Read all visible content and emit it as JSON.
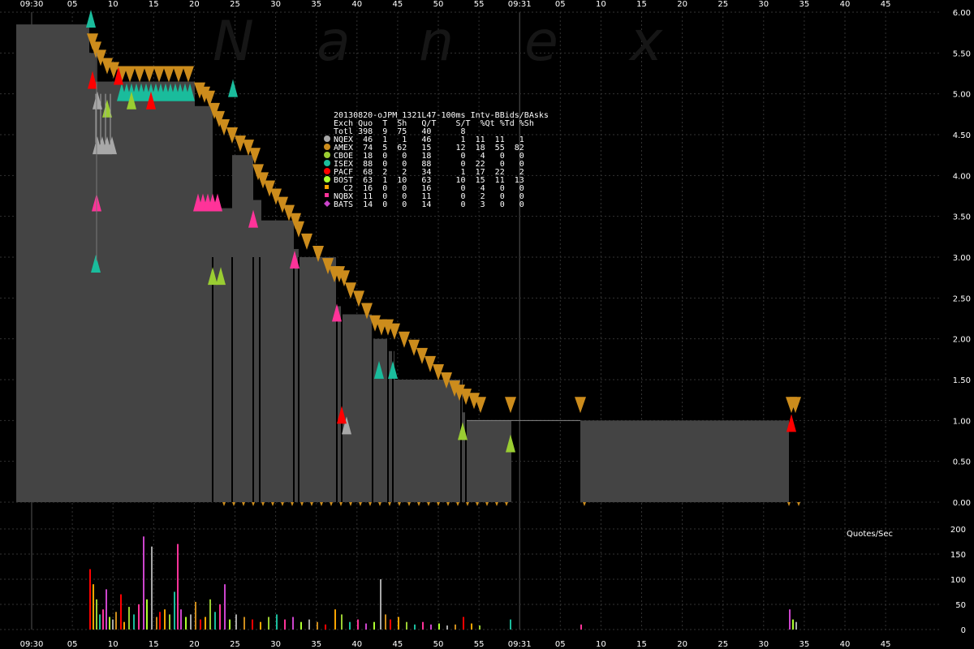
{
  "chart_data": {
    "type": "area",
    "watermark": [
      "N",
      "a",
      "n",
      "e",
      "x"
    ],
    "x_ticks": [
      "09:30",
      "05",
      "10",
      "15",
      "20",
      "25",
      "30",
      "35",
      "40",
      "45",
      "50",
      "55",
      "09:31",
      "05",
      "10",
      "15",
      "20",
      "25",
      "30",
      "35",
      "40",
      "45"
    ],
    "y_ticks": [
      "6.00",
      "5.50",
      "5.00",
      "4.50",
      "4.00",
      "3.50",
      "3.00",
      "2.50",
      "2.00",
      "1.50",
      "1.00",
      "0.50",
      "0.00"
    ],
    "y_values": [
      6.0,
      5.5,
      5.0,
      4.5,
      4.0,
      3.5,
      3.0,
      2.5,
      2.0,
      1.5,
      1.0,
      0.5,
      0.0
    ],
    "ylim": [
      0,
      6.0
    ],
    "volume_label": "Quotes/Sec",
    "volume_ticks": [
      "200",
      "150",
      "100",
      "50",
      "0"
    ],
    "volume_values": [
      200,
      150,
      100,
      50,
      0
    ],
    "volume_ylim": [
      0,
      200
    ],
    "legend": {
      "title": "20130820-oJPM_1321L47-100ms Intv-BBids/BAsks",
      "header": "Exch Quo  T  Sh   Q/T    S/T  %Qt %Td %Sh",
      "total": "Totl 398  9  75   40      8",
      "rows": [
        {
          "marker": "circle",
          "color": "#a8a8a8",
          "text": "NQEX  46  1   1   46      1  11  11   1"
        },
        {
          "marker": "circle",
          "color": "#cc8c1c",
          "text": "AMEX  74  5  62   15     12  18  55  82"
        },
        {
          "marker": "circle",
          "color": "#9acd32",
          "text": "CBOE  18  0   0   18      0   4   0   0"
        },
        {
          "marker": "circle",
          "color": "#1abc9c",
          "text": "ISEX  88  0   0   88      0  22   0   0"
        },
        {
          "marker": "circle",
          "color": "#ff0000",
          "text": "PACF  68  2   2   34      1  17  22   2"
        },
        {
          "marker": "circle",
          "color": "#adff2f",
          "text": "BOST  63  1  10   63     10  15  11  13"
        },
        {
          "marker": "square",
          "color": "#ffa500",
          "text": "  C2  16  0   0   16      0   4   0   0"
        },
        {
          "marker": "square",
          "color": "#ff3399",
          "text": "NQBX  11  0   0   11      0   2   0   0"
        },
        {
          "marker": "diamond",
          "color": "#cc44cc",
          "text": "BATS  14  0   0   14      0   3   0   0"
        }
      ]
    },
    "colors": {
      "area": "#444444",
      "ask": "#cc8c1c",
      "bid_grey": "#a8a8a8",
      "bid_green": "#9acd32",
      "bid_teal": "#1abc9c",
      "bid_pink": "#ff3399",
      "bid_red": "#ff0000"
    }
  }
}
